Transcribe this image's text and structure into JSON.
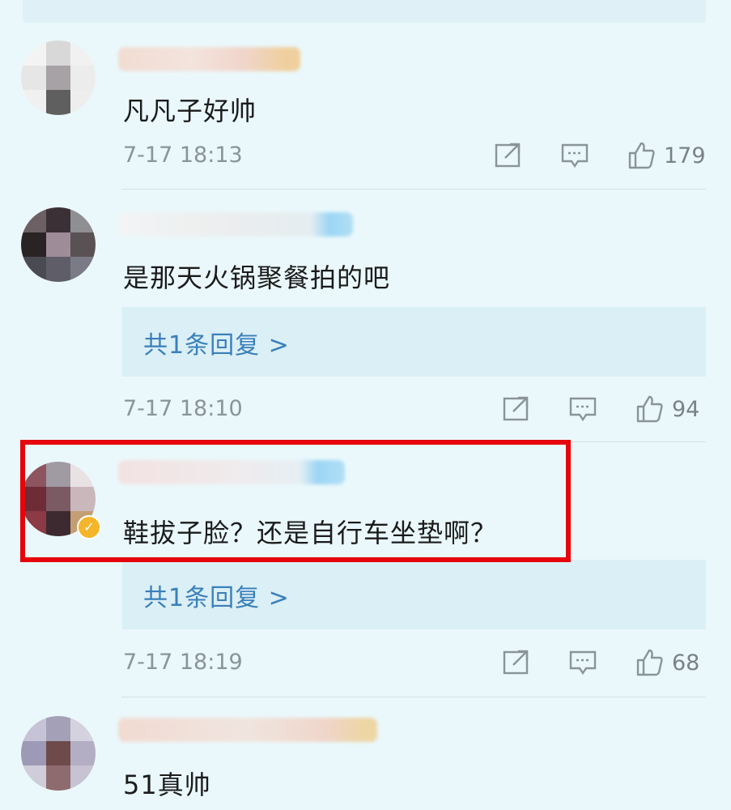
{
  "comments": [
    {
      "text": "凡凡子好帅",
      "time": "7-17 18:13",
      "likes": "179",
      "reply_count_label": ""
    },
    {
      "text": "是那天火锅聚餐拍的吧",
      "time": "7-17 18:10",
      "likes": "94",
      "reply_count_label": "共1条回复 >"
    },
    {
      "text": "鞋拔子脸？还是自行车坐垫啊？",
      "time": "7-17 18:19",
      "likes": "68",
      "reply_count_label": "共1条回复 >",
      "verified": true
    },
    {
      "text": "51真帅"
    }
  ],
  "icons": {
    "share": "share-icon",
    "comment": "comment-icon",
    "like": "thumbs-up-icon"
  },
  "colors": {
    "background": "#eaf8fb",
    "reply_box": "#dbeff6",
    "link": "#3a7fba",
    "highlight": "#e5050b",
    "verified_badge": "#f4b52b"
  }
}
